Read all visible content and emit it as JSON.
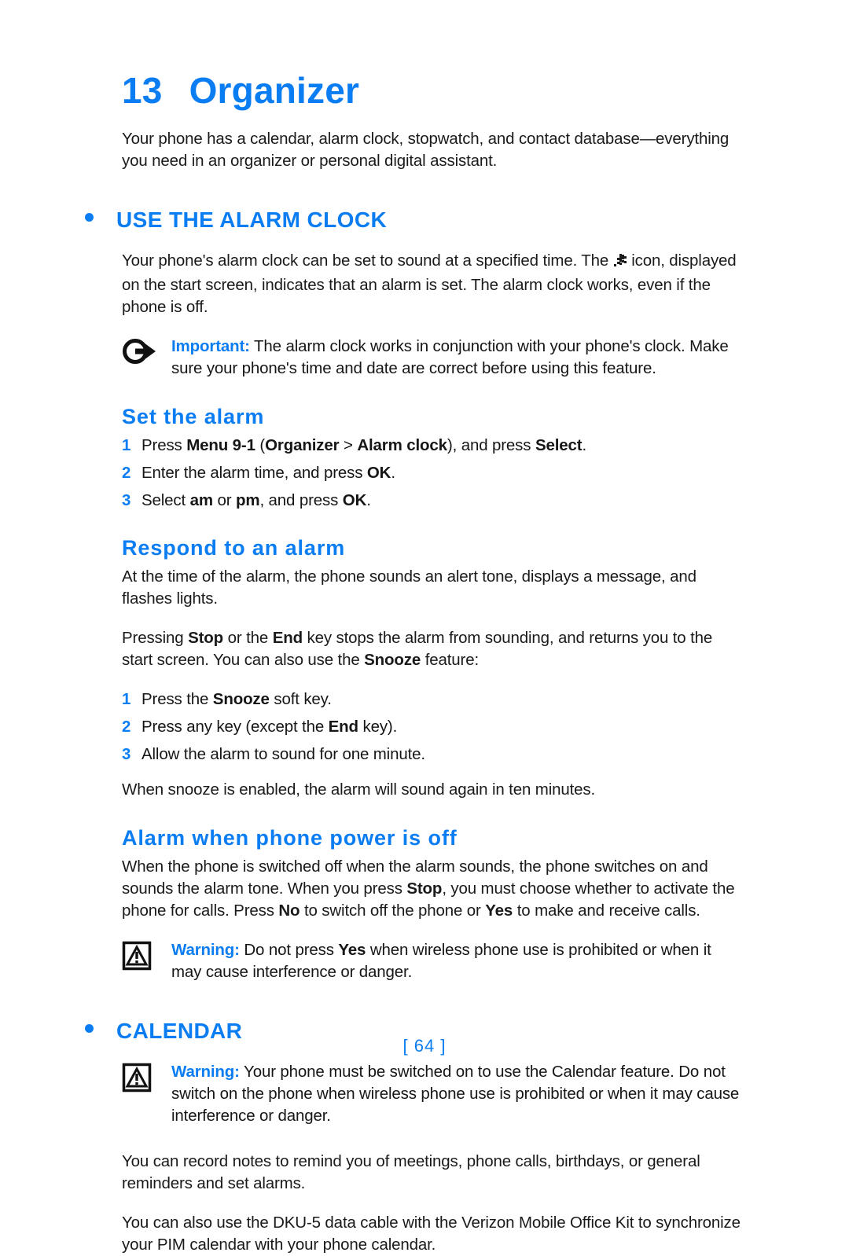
{
  "document": {
    "chapter_number": "13",
    "chapter_title": "Organizer",
    "page_footer": "[ 64 ]",
    "accent_color": "#0b7df2",
    "text_color": "#1a1a1a"
  },
  "intro": {
    "paragraph": "Your phone has a calendar, alarm clock, stopwatch, and contact database—everything you need in an organizer or personal digital assistant."
  },
  "sections": [
    {
      "heading": "USE THE ALARM CLOCK",
      "intro_before_icon": "Your phone's alarm clock can be set to sound at a specified time. The",
      "icon_name": "alarm-clock-icon",
      "intro_after_icon": "icon, displayed on the start screen, indicates that an alarm is set. The alarm clock works, even if the phone is off.",
      "note": {
        "icon_name": "important-arrow-icon",
        "label": "Important:",
        "text": "The alarm clock works in conjunction with your phone's clock. Make sure your phone's time and date are correct before using this feature."
      },
      "subsections": [
        {
          "heading": "Set the alarm",
          "steps": [
            {
              "num": "1",
              "parts": [
                {
                  "t": "Press ",
                  "b": false
                },
                {
                  "t": "Menu 9-1",
                  "b": true
                },
                {
                  "t": " (",
                  "b": false
                },
                {
                  "t": "Organizer",
                  "b": true
                },
                {
                  "t": " > ",
                  "b": false
                },
                {
                  "t": "Alarm clock",
                  "b": true
                },
                {
                  "t": "), and press ",
                  "b": false
                },
                {
                  "t": "Select",
                  "b": true
                },
                {
                  "t": ".",
                  "b": false
                }
              ]
            },
            {
              "num": "2",
              "parts": [
                {
                  "t": "Enter the alarm time, and press ",
                  "b": false
                },
                {
                  "t": "OK",
                  "b": true
                },
                {
                  "t": ".",
                  "b": false
                }
              ]
            },
            {
              "num": "3",
              "parts": [
                {
                  "t": "Select ",
                  "b": false
                },
                {
                  "t": "am",
                  "b": true
                },
                {
                  "t": " or ",
                  "b": false
                },
                {
                  "t": "pm",
                  "b": true
                },
                {
                  "t": ", and press ",
                  "b": false
                },
                {
                  "t": "OK",
                  "b": true
                },
                {
                  "t": ".",
                  "b": false
                }
              ]
            }
          ]
        },
        {
          "heading": "Respond to an alarm",
          "para1": "At the time of the alarm, the phone sounds an alert tone, displays a message, and flashes lights.",
          "para2_parts": [
            {
              "t": "Pressing ",
              "b": false
            },
            {
              "t": "Stop",
              "b": true
            },
            {
              "t": " or the ",
              "b": false
            },
            {
              "t": "End",
              "b": true
            },
            {
              "t": " key stops the alarm from sounding, and returns you to the start screen. You can also use the ",
              "b": false
            },
            {
              "t": "Snooze",
              "b": true
            },
            {
              "t": " feature:",
              "b": false
            }
          ],
          "steps": [
            {
              "num": "1",
              "parts": [
                {
                  "t": "Press the ",
                  "b": false
                },
                {
                  "t": "Snooze",
                  "b": true
                },
                {
                  "t": " soft key.",
                  "b": false
                }
              ]
            },
            {
              "num": "2",
              "parts": [
                {
                  "t": "Press any key (except the ",
                  "b": false
                },
                {
                  "t": "End",
                  "b": true
                },
                {
                  "t": " key).",
                  "b": false
                }
              ]
            },
            {
              "num": "3",
              "parts": [
                {
                  "t": "Allow the alarm to sound for one minute.",
                  "b": false
                }
              ]
            }
          ],
          "para3": "When snooze is enabled, the alarm will sound again in ten minutes."
        },
        {
          "heading": "Alarm when phone power is off",
          "para1_parts": [
            {
              "t": "When the phone is switched off when the alarm sounds, the phone switches on and sounds the alarm tone. When you press ",
              "b": false
            },
            {
              "t": "Stop",
              "b": true
            },
            {
              "t": ", you must choose whether to activate the phone for calls. Press ",
              "b": false
            },
            {
              "t": "No",
              "b": true
            },
            {
              "t": " to switch off the phone or ",
              "b": false
            },
            {
              "t": "Yes",
              "b": true
            },
            {
              "t": " to make and receive calls.",
              "b": false
            }
          ],
          "note": {
            "icon_name": "warning-triangle-icon",
            "label": "Warning:",
            "parts": [
              {
                "t": "Do not press ",
                "b": false
              },
              {
                "t": "Yes",
                "b": true
              },
              {
                "t": " when wireless phone use is prohibited or when it may cause interference or danger.",
                "b": false
              }
            ]
          }
        }
      ]
    },
    {
      "heading": "CALENDAR",
      "note": {
        "icon_name": "warning-triangle-icon",
        "label": "Warning:",
        "text": "Your phone must be switched on to use the Calendar feature. Do not switch on the phone when wireless phone use is prohibited or when it may cause interference or danger."
      },
      "para1": "You can record notes to remind you of meetings, phone calls, birthdays, or general reminders and set alarms.",
      "para2": "You can also use the DKU-5 data cable with the Verizon Mobile Office Kit to synchronize your PIM calendar with your phone calendar."
    }
  ]
}
